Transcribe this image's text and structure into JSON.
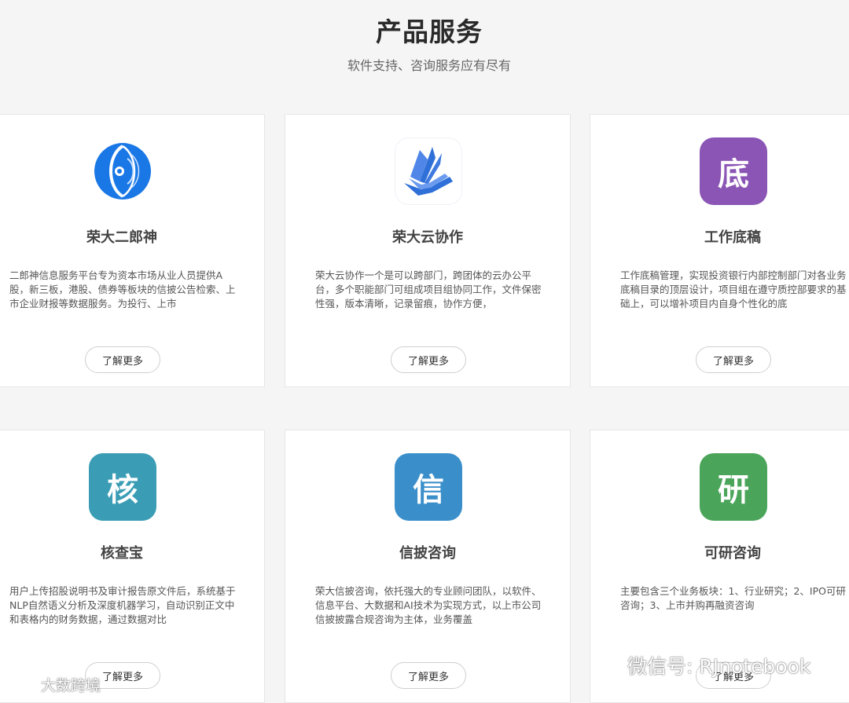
{
  "header": {
    "title": "产品服务",
    "subtitle": "软件支持、咨询服务应有尽有"
  },
  "more_label": "了解更多",
  "cards": [
    {
      "title": "荣大二郎神",
      "desc": "二郎神信息服务平台专为资本市场从业人员提供A股，新三板，港股、债券等板块的信披公告检索、上市企业财报等数据服务。为投行、上市",
      "icon": "erlangshen-eye-logo",
      "color": "#1a78e6"
    },
    {
      "title": "荣大云协作",
      "desc": "荣大云协作一个是可以跨部门，跨团体的云办公平台，多个职能部门可组成项目组协同工作，文件保密性强，版本清晰，记录留痕，协作方便，",
      "icon": "cloud-collab-book-logo",
      "color": "#2f6fd8"
    },
    {
      "title": "工作底稿",
      "desc": "工作底稿管理，实现投资银行内部控制部门对各业务底稿目录的顶层设计，项目组在遵守质控部要求的基础上，可以增补项目内自身个性化的底",
      "icon_char": "底",
      "color": "#8a55b5"
    },
    {
      "title": "核查宝",
      "desc": "用户上传招股说明书及审计报告原文件后，系统基于NLP自然语义分析及深度机器学习，自动识别正文中和表格内的财务数据，通过数据对比",
      "icon_char": "核",
      "color": "#3a9db5"
    },
    {
      "title": "信披咨询",
      "desc": "荣大信披咨询，依托强大的专业顾问团队，以软件、信息平台、大数据和AI技术为实现方式，以上市公司信披披露合规咨询为主体，业务覆盖",
      "icon_char": "信",
      "color": "#3a8fcb"
    },
    {
      "title": "可研咨询",
      "desc": "主要包含三个业务板块：1、行业研究；2、IPO可研咨询；3、上市并购再融资咨询",
      "icon_char": "研",
      "color": "#4aa55a"
    }
  ],
  "watermarks": {
    "left": "大数跨境",
    "right": "微信号: RJnotebook"
  }
}
